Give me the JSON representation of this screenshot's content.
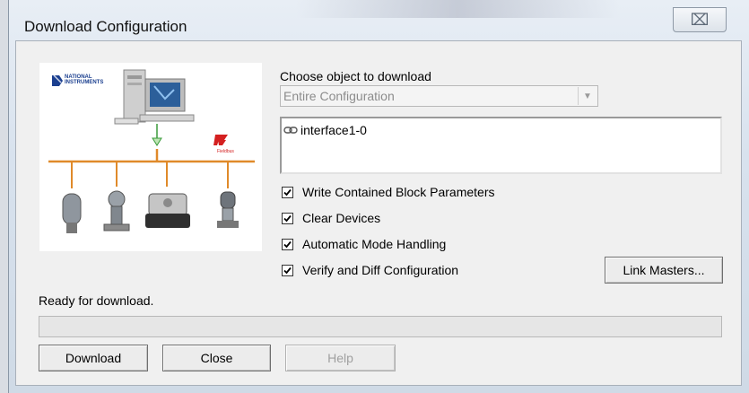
{
  "window": {
    "title": "Download Configuration",
    "close_glyph": "⌧"
  },
  "diagram": {
    "brand_line1": "NATIONAL",
    "brand_line2": "INSTRUMENTS",
    "fieldbus_label": "Fieldbus"
  },
  "object_chooser": {
    "label": "Choose object to download",
    "selected": "Entire Configuration",
    "items": [
      {
        "icon": "link-icon",
        "label": "interface1-0"
      }
    ]
  },
  "options": [
    {
      "label": "Write Contained Block Parameters",
      "checked": true
    },
    {
      "label": "Clear Devices",
      "checked": true
    },
    {
      "label": "Automatic Mode Handling",
      "checked": true
    },
    {
      "label": "Verify and Diff Configuration",
      "checked": true
    }
  ],
  "buttons": {
    "link_masters": "Link Masters...",
    "download": "Download",
    "close": "Close",
    "help": "Help"
  },
  "status": {
    "text": "Ready for download.",
    "progress": 0
  }
}
